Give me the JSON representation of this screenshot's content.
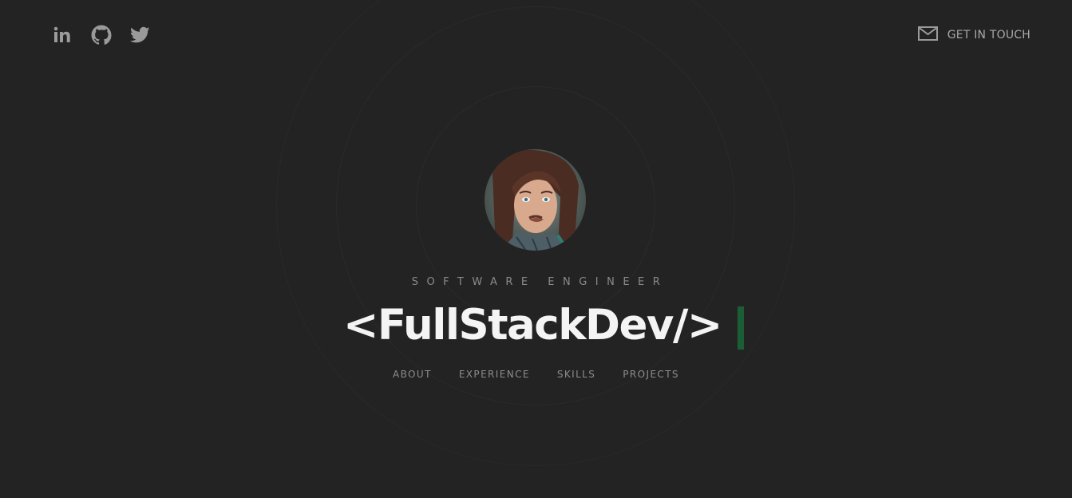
{
  "header": {
    "socials": [
      {
        "icon": "linkedin-icon"
      },
      {
        "icon": "github-icon"
      },
      {
        "icon": "twitter-icon"
      }
    ],
    "contact": {
      "icon": "mail-icon",
      "label": "GET IN TOUCH"
    }
  },
  "hero": {
    "avatar_icon": "profile-photo",
    "role": "SOFTWARE ENGINEER",
    "headline": "<FullStackDev/>",
    "cursor_color": "#1b5e36"
  },
  "nav": {
    "items": [
      {
        "label": "ABOUT"
      },
      {
        "label": "EXPERIENCE"
      },
      {
        "label": "SKILLS"
      },
      {
        "label": "PROJECTS"
      }
    ]
  },
  "colors": {
    "background": "#232323",
    "icon": "#9a9a9a",
    "headline": "#f4f4f4",
    "muted_text": "#8d8d8d"
  }
}
